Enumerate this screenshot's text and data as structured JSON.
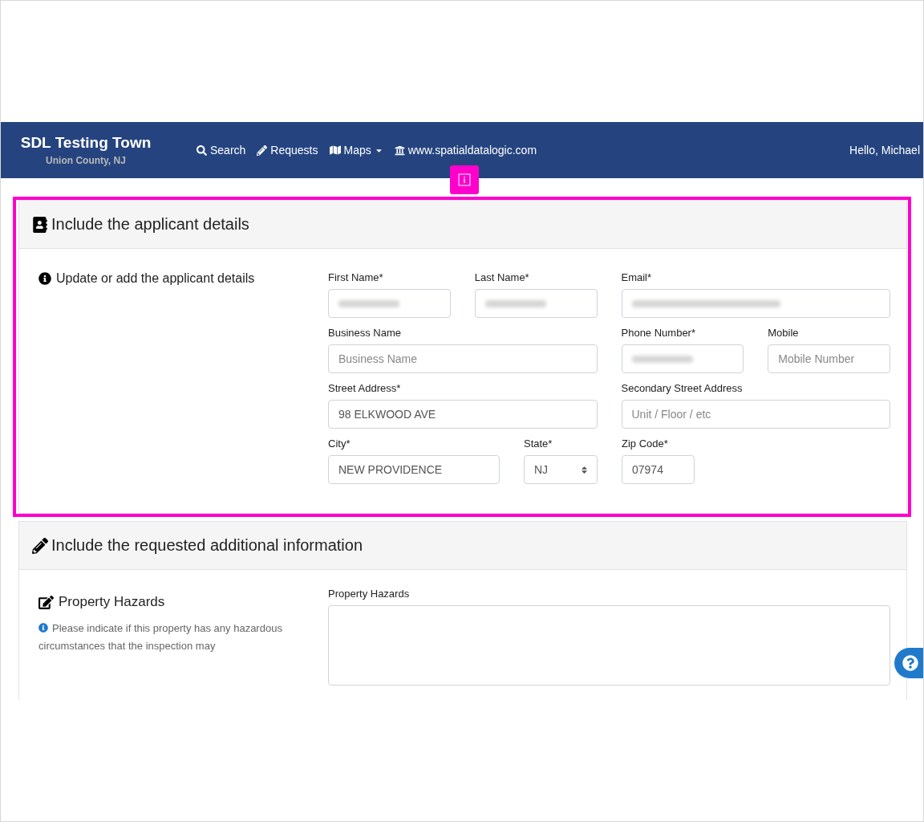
{
  "navbar": {
    "title": "SDL Testing Town",
    "subtitle": "Union County, NJ",
    "items": [
      {
        "label": "Search",
        "dropdown": false
      },
      {
        "label": "Requests",
        "dropdown": false
      },
      {
        "label": "Maps",
        "dropdown": true
      },
      {
        "label": "www.spatialdatalogic.com",
        "dropdown": false
      }
    ],
    "greeting": "Hello, Michael"
  },
  "applicant_section": {
    "title": "Include the applicant details",
    "highlighted": true,
    "intro": "Update or add the applicant details",
    "rows": [
      [
        {
          "label": "First Name*",
          "kind": "text",
          "redacted": true
        },
        {
          "label": "Last Name*",
          "kind": "text",
          "redacted": true
        },
        {
          "label": "Email*",
          "kind": "text",
          "redacted": true
        }
      ],
      [
        {
          "label": "Business Name",
          "kind": "text",
          "placeholder": "Business Name"
        },
        {
          "label": "Phone Number*",
          "kind": "text",
          "redacted": true
        },
        {
          "label": "Mobile",
          "kind": "text",
          "placeholder": "Mobile Number"
        }
      ],
      [
        {
          "label": "Street Address*",
          "kind": "text",
          "value": "98 ELKWOOD AVE"
        },
        {
          "label": "Secondary Street Address",
          "kind": "text",
          "placeholder": "Unit / Floor / etc"
        }
      ],
      [
        {
          "label": "City*",
          "kind": "text",
          "value": "NEW PROVIDENCE"
        },
        {
          "label": "State*",
          "kind": "select",
          "value": "NJ"
        },
        {
          "label": "Zip Code*",
          "kind": "text",
          "value": "07974"
        }
      ]
    ]
  },
  "additional_section": {
    "title": "Include the requested additional information",
    "heading": "Property Hazards",
    "help": "Please indicate if this property has any hazardous circumstances that the inspection may",
    "field_label": "Property Hazards"
  }
}
